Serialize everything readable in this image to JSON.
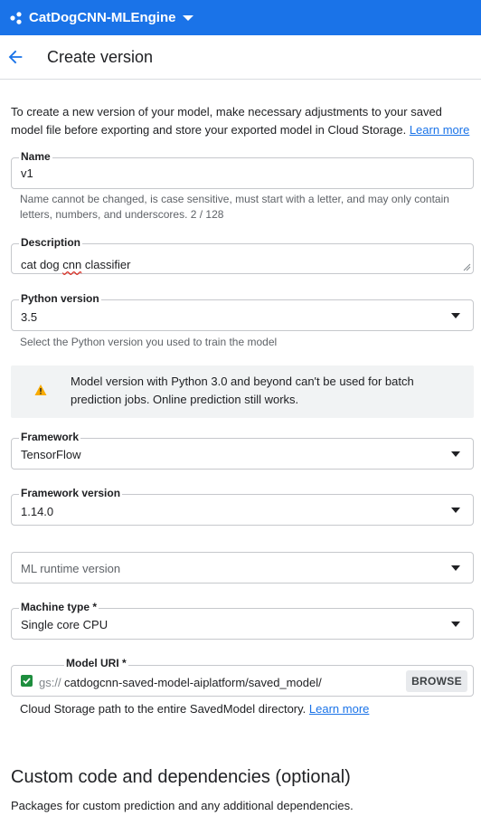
{
  "topbar": {
    "project_name": "CatDogCNN-MLEngine"
  },
  "header": {
    "title": "Create version"
  },
  "intro": {
    "text": "To create a new version of your model, make necessary adjustments to your saved model file before exporting and store your exported model in Cloud Storage.",
    "link": "Learn more"
  },
  "name_field": {
    "label": "Name",
    "value": "v1",
    "hint": "Name cannot be changed, is case sensitive, must start with a letter, and may only contain letters, numbers, and underscores. 2 / 128"
  },
  "description_field": {
    "label": "Description",
    "value_pre": "cat dog ",
    "value_spell": "cnn",
    "value_post": " classifier"
  },
  "python_field": {
    "label": "Python version",
    "value": "3.5",
    "hint": "Select the Python version you used to train the model"
  },
  "warning": {
    "text": "Model version with Python 3.0 and beyond can't be used for batch prediction jobs. Online prediction still works."
  },
  "framework_field": {
    "label": "Framework",
    "value": "TensorFlow"
  },
  "framework_version_field": {
    "label": "Framework version",
    "value": "1.14.0"
  },
  "runtime_field": {
    "placeholder": "ML runtime version"
  },
  "machine_field": {
    "label": "Machine type *",
    "value": "Single core CPU"
  },
  "model_uri_field": {
    "label": "Model URI *",
    "prefix": "gs://",
    "value": "catdogcnn-saved-model-aiplatform/saved_model/",
    "browse_label": "BROWSE",
    "hint": "Cloud Storage path to the entire SavedModel directory.",
    "hint_link": "Learn more"
  },
  "custom_code": {
    "title": "Custom code and dependencies (optional)",
    "description": "Packages for custom prediction and any additional dependencies."
  },
  "colors": {
    "brand": "#1a73e8",
    "warning_icon": "#f9ab00",
    "check": "#1e8e3e"
  }
}
